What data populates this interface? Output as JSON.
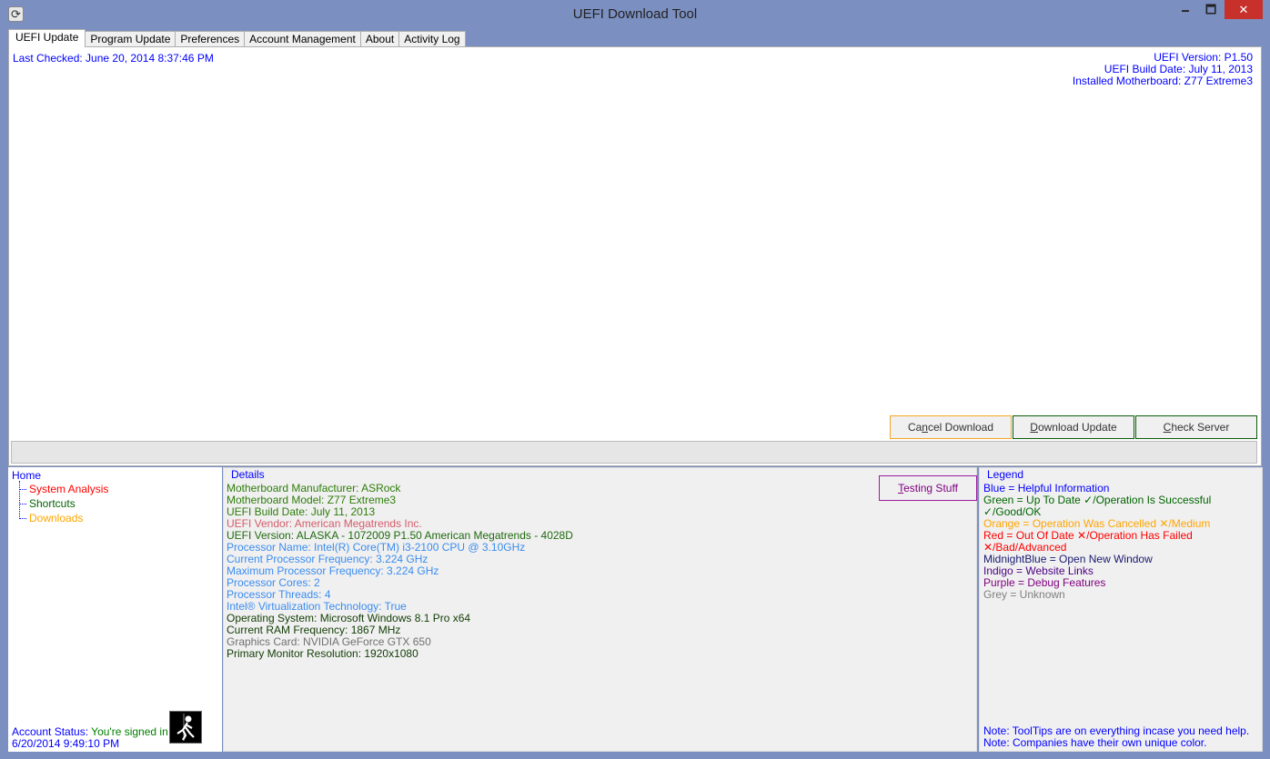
{
  "window": {
    "title": "UEFI Download Tool",
    "app_icon": "refresh-icon",
    "min": "🗕",
    "max": "🗖",
    "close": "✕"
  },
  "tabs": [
    {
      "label": "UEFI Update",
      "active": true
    },
    {
      "label": "Program Update"
    },
    {
      "label": "Preferences"
    },
    {
      "label": "Account Management"
    },
    {
      "label": "About"
    },
    {
      "label": "Activity Log"
    }
  ],
  "main": {
    "last_checked": "Last Checked: June 20, 2014 8:37:46 PM",
    "uefi_version": "UEFI Version: P1.50",
    "uefi_build_date": "UEFI Build Date: July 11, 2013",
    "installed_motherboard": "Installed Motherboard: Z77 Extreme3",
    "buttons": {
      "cancel_pre": "Ca",
      "cancel_u": "n",
      "cancel_post": "cel Download",
      "download_u": "D",
      "download_post": "ownload Update",
      "check_u": "C",
      "check_post": "heck Server"
    },
    "progress": 0
  },
  "tree": {
    "root": "Home",
    "items": [
      {
        "label": "System Analysis",
        "color": "#ff0000"
      },
      {
        "label": "Shortcuts",
        "color": "#006400"
      },
      {
        "label": "Downloads",
        "color": "#ffa500"
      }
    ]
  },
  "details": {
    "title": "Details",
    "testing_u": "T",
    "testing_post": "esting Stuff",
    "lines": [
      {
        "text": "Motherboard Manufacturer: ASRock",
        "color": "#2e7d0a"
      },
      {
        "text": "Motherboard Model: Z77 Extreme3",
        "color": "#2e7d0a"
      },
      {
        "text": "UEFI Build Date: July 11, 2013",
        "color": "#2e7d0a"
      },
      {
        "text": "UEFI Vendor: American Megatrends Inc.",
        "color": "#d45c6a"
      },
      {
        "text": "UEFI Version: ALASKA - 1072009 P1.50 American Megatrends - 4028D",
        "color": "#1f6a10"
      },
      {
        "text": "Processor Name: Intel(R) Core(TM) i3-2100 CPU @ 3.10GHz",
        "color": "#3a8cf0"
      },
      {
        "text": "Current Processor Frequency: 3.224 GHz",
        "color": "#3a8cf0"
      },
      {
        "text": "Maximum Processor Frequency: 3.224 GHz",
        "color": "#3a8cf0"
      },
      {
        "text": "Processor Cores: 2",
        "color": "#3a8cf0"
      },
      {
        "text": "Processor Threads: 4",
        "color": "#3a8cf0"
      },
      {
        "text": "Intel® Virtualization Technology: True",
        "color": "#3a8cf0"
      },
      {
        "text": "Operating System: Microsoft Windows 8.1 Pro x64",
        "color": "#123d05"
      },
      {
        "text": "Current RAM Frequency: 1867 MHz",
        "color": "#123d05"
      },
      {
        "text": "Graphics Card: NVIDIA GeForce GTX 650",
        "color": "#707070"
      },
      {
        "text": "Primary Monitor Resolution: 1920x1080",
        "color": "#123d05"
      }
    ]
  },
  "legend": {
    "title": "Legend",
    "lines": [
      {
        "text": "Blue = Helpful Information",
        "color": "#0000ff"
      },
      {
        "text": "Green = Up To Date ✓/Operation Is Successful ✓/Good/OK",
        "color": "#006400"
      },
      {
        "text": "Orange = Operation Was Cancelled ✕/Medium",
        "color": "#ffa500"
      },
      {
        "text": "Red = Out Of Date ✕/Operation Has Failed ✕/Bad/Advanced",
        "color": "#ff0000"
      },
      {
        "text": "MidnightBlue = Open New Window",
        "color": "#191970"
      },
      {
        "text": "Indigo = Website Links",
        "color": "#4b0082"
      },
      {
        "text": "Purple = Debug Features",
        "color": "#800080"
      },
      {
        "text": "Grey = Unknown",
        "color": "#808080"
      }
    ],
    "notes": [
      "Note: ToolTips are on everything incase you need help.",
      "Note: Companies have their own unique color."
    ]
  },
  "account": {
    "label": "Account Status: ",
    "status": "You're signed in ✓",
    "timestamp": "6/20/2014 9:49:10 PM"
  }
}
